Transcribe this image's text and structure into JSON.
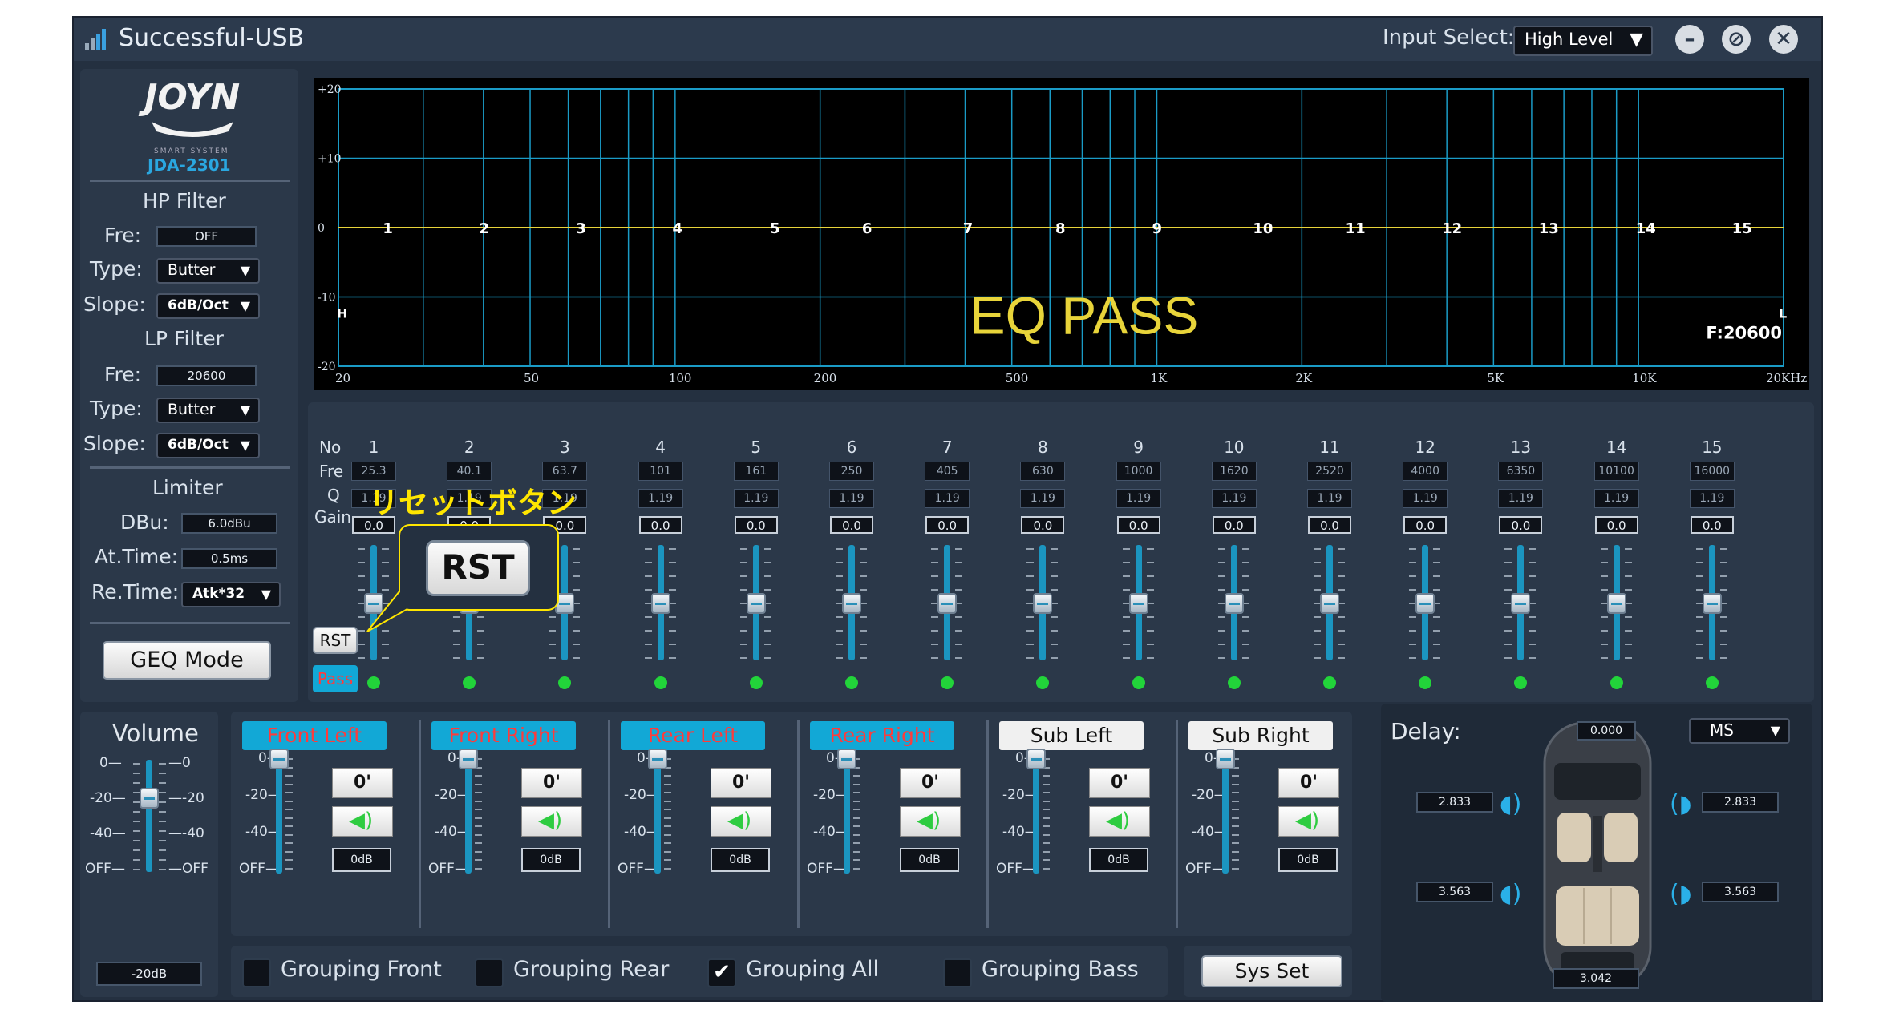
{
  "app": {
    "title": "Successful-USB"
  },
  "input_select": {
    "label": "Input Select:",
    "value": "High Level"
  },
  "logo": {
    "brand": "JOYN",
    "tagline": "SMART SYSTEM",
    "model": "JDA-2301"
  },
  "hp_filter": {
    "title": "HP Filter",
    "fre_label": "Fre:",
    "fre_value": "OFF",
    "type_label": "Type:",
    "type_value": "Butter",
    "slope_label": "Slope:",
    "slope_value": "6dB/Oct"
  },
  "lp_filter": {
    "title": "LP Filter",
    "fre_label": "Fre:",
    "fre_value": "20600",
    "type_label": "Type:",
    "type_value": "Butter",
    "slope_label": "Slope:",
    "slope_value": "6dB/Oct"
  },
  "limiter": {
    "title": "Limiter",
    "dbu_label": "DBu:",
    "dbu_value": "6.0dBu",
    "attime_label": "At.Time:",
    "attime_value": "0.5ms",
    "retime_label": "Re.Time:",
    "retime_value": "Atk*32"
  },
  "geq_mode_label": "GEQ Mode",
  "graph": {
    "y_ticks": [
      "+20",
      "+10",
      "0",
      "-10",
      "-20"
    ],
    "x_ticks": [
      "20",
      "50",
      "100",
      "200",
      "500",
      "1K",
      "2K",
      "5K",
      "10K",
      "20KHz"
    ],
    "band_markers": [
      "1",
      "2",
      "3",
      "4",
      "5",
      "6",
      "7",
      "8",
      "9",
      "10",
      "11",
      "12",
      "13",
      "14",
      "15"
    ],
    "h_marker": "H",
    "l_marker": "L",
    "overlay_text": "EQ PASS",
    "freq_readout": "F:20600"
  },
  "eq": {
    "row_labels": {
      "no": "No",
      "fre": "Fre",
      "q": "Q",
      "gain": "Gain"
    },
    "bands": [
      {
        "no": "1",
        "fre": "25.3",
        "q": "1.19",
        "gain": "0.0"
      },
      {
        "no": "2",
        "fre": "40.1",
        "q": "1.19",
        "gain": "0.0"
      },
      {
        "no": "3",
        "fre": "63.7",
        "q": "1.19",
        "gain": "0.0"
      },
      {
        "no": "4",
        "fre": "101",
        "q": "1.19",
        "gain": "0.0"
      },
      {
        "no": "5",
        "fre": "161",
        "q": "1.19",
        "gain": "0.0"
      },
      {
        "no": "6",
        "fre": "250",
        "q": "1.19",
        "gain": "0.0"
      },
      {
        "no": "7",
        "fre": "405",
        "q": "1.19",
        "gain": "0.0"
      },
      {
        "no": "8",
        "fre": "630",
        "q": "1.19",
        "gain": "0.0"
      },
      {
        "no": "9",
        "fre": "1000",
        "q": "1.19",
        "gain": "0.0"
      },
      {
        "no": "10",
        "fre": "1620",
        "q": "1.19",
        "gain": "0.0"
      },
      {
        "no": "11",
        "fre": "2520",
        "q": "1.19",
        "gain": "0.0"
      },
      {
        "no": "12",
        "fre": "4000",
        "q": "1.19",
        "gain": "0.0"
      },
      {
        "no": "13",
        "fre": "6350",
        "q": "1.19",
        "gain": "0.0"
      },
      {
        "no": "14",
        "fre": "10100",
        "q": "1.19",
        "gain": "0.0"
      },
      {
        "no": "15",
        "fre": "16000",
        "q": "1.19",
        "gain": "0.0"
      }
    ],
    "rst_label": "RST",
    "pass_label": "Pass"
  },
  "annotation": {
    "text": "リセットボタン",
    "callout_label": "RST"
  },
  "volume": {
    "title": "Volume",
    "scale": [
      "0",
      "-20",
      "-40",
      "OFF"
    ],
    "value": "-20dB"
  },
  "channels": [
    {
      "name": "Front Left",
      "phase": "0'",
      "db": "0dB",
      "color": "#12a8d6",
      "text_color": "#ff3b3b"
    },
    {
      "name": "Front Right",
      "phase": "0'",
      "db": "0dB",
      "color": "#12a8d6",
      "text_color": "#ff3b3b"
    },
    {
      "name": "Rear Left",
      "phase": "0'",
      "db": "0dB",
      "color": "#12a8d6",
      "text_color": "#ff3b3b"
    },
    {
      "name": "Rear Right",
      "phase": "0'",
      "db": "0dB",
      "color": "#12a8d6",
      "text_color": "#ff3b3b"
    },
    {
      "name": "Sub Left",
      "phase": "0'",
      "db": "0dB",
      "color": "#f0f0f0",
      "text_color": "#111111"
    },
    {
      "name": "Sub Right",
      "phase": "0'",
      "db": "0dB",
      "color": "#f0f0f0",
      "text_color": "#111111"
    }
  ],
  "channel_scale": [
    "0",
    "-20",
    "-40",
    "OFF"
  ],
  "grouping": [
    {
      "label": "Grouping Front",
      "checked": false
    },
    {
      "label": "Grouping Rear",
      "checked": false
    },
    {
      "label": "Grouping All",
      "checked": true
    },
    {
      "label": "Grouping Bass",
      "checked": false
    }
  ],
  "sys_set_label": "Sys Set",
  "delay": {
    "title": "Delay:",
    "unit": "MS",
    "top": "0.000",
    "front_left": "2.833",
    "front_right": "2.833",
    "rear_left": "3.563",
    "rear_right": "3.563",
    "bottom": "3.042"
  },
  "colors": {
    "accent": "#12a8d6",
    "eq_line": "#e8d43a",
    "overlay_text": "#e8d43a",
    "annotation": "#ffe600",
    "led": "#22d43a"
  }
}
